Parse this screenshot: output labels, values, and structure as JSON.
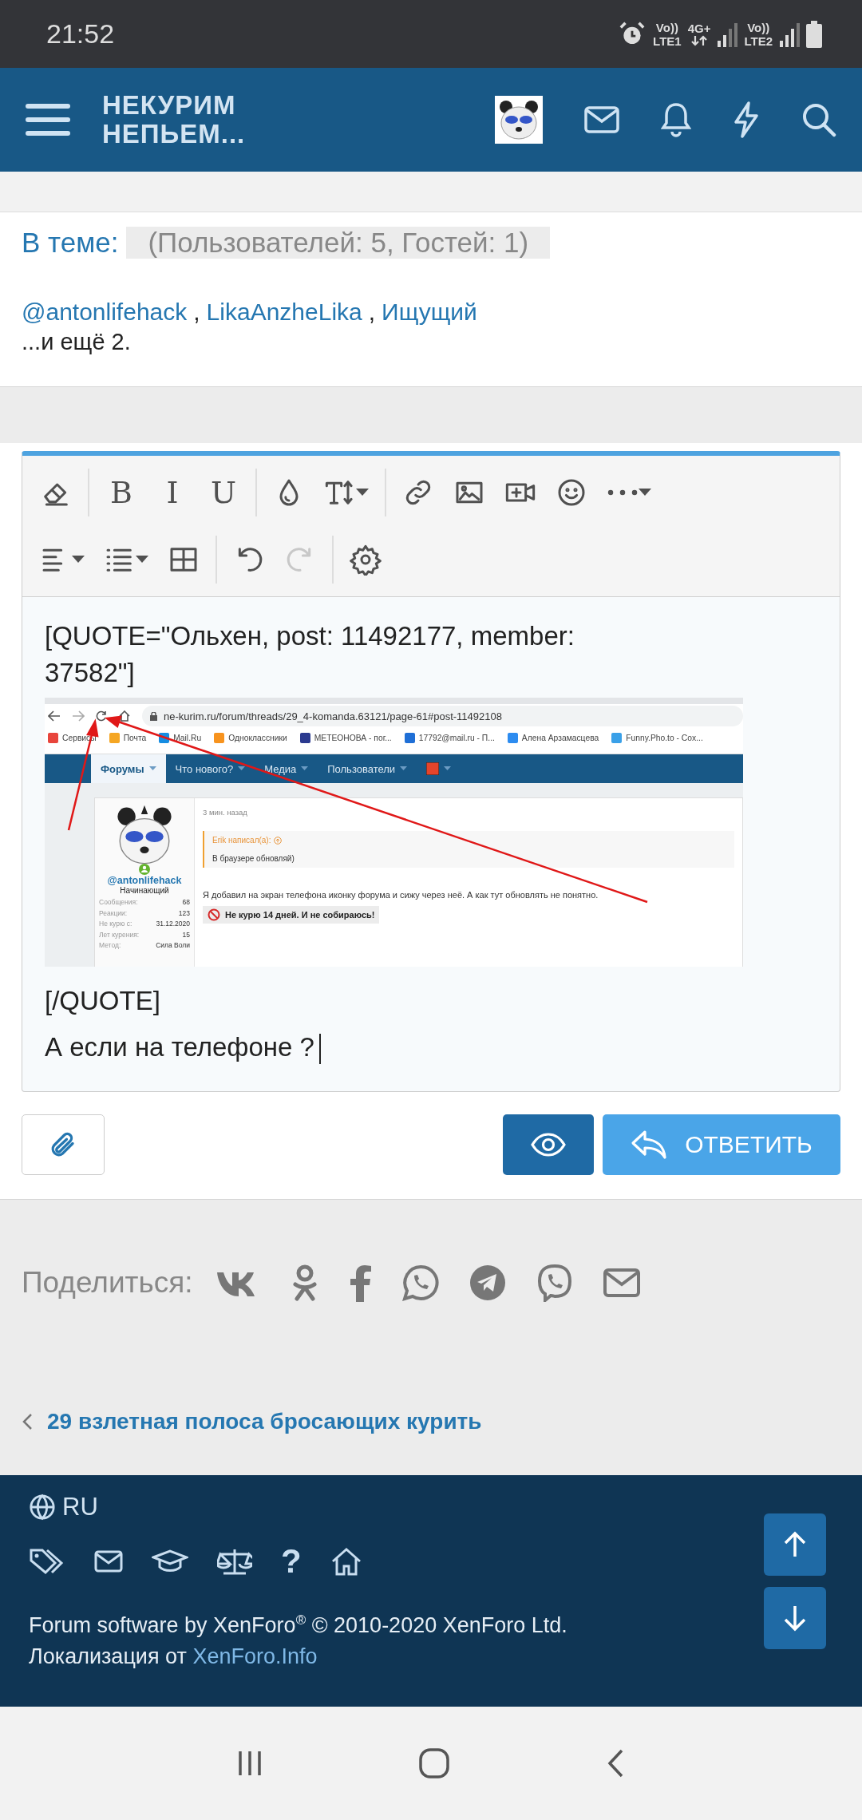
{
  "status_bar": {
    "time": "21:52",
    "sim1": {
      "voice": "Vo))",
      "network": "LTE1"
    },
    "data": "4G+",
    "sim2": {
      "voice": "Vo))",
      "network": "LTE2"
    }
  },
  "header": {
    "logo": [
      "НЕКУРИМ",
      "НЕПЬЕМ..."
    ]
  },
  "online": {
    "title": "В теме:",
    "counts": "(Пользователей: 5, Гостей: 1)",
    "users": [
      {
        "kind": "link",
        "text": "@antonlifehack"
      },
      {
        "kind": "separator",
        "text": ","
      },
      {
        "kind": "link",
        "text": "LikaAnzheLika"
      },
      {
        "kind": "separator",
        "text": ","
      },
      {
        "kind": "link",
        "text": "Ищущий"
      }
    ],
    "more": "...и ещё 2."
  },
  "editor": {
    "toolbar": [
      [
        [
          {
            "kind": "icon",
            "disabled": false,
            "dropdown": false
          }
        ],
        [
          {
            "kind": "label",
            "label": "B",
            "disabled": false,
            "dropdown": false
          },
          {
            "kind": "label",
            "label": "I",
            "disabled": false,
            "dropdown": false
          },
          {
            "kind": "label",
            "label": "U",
            "disabled": false,
            "dropdown": false
          }
        ],
        [
          {
            "kind": "icon",
            "disabled": false,
            "dropdown": false
          },
          {
            "kind": "icon",
            "disabled": false,
            "dropdown": true
          }
        ],
        [
          {
            "kind": "icon",
            "disabled": false,
            "dropdown": false
          },
          {
            "kind": "icon",
            "disabled": false,
            "dropdown": false
          },
          {
            "kind": "icon",
            "disabled": false,
            "dropdown": false
          },
          {
            "kind": "icon",
            "disabled": false,
            "dropdown": false
          },
          {
            "kind": "icon",
            "disabled": false,
            "dropdown": true
          }
        ]
      ],
      [
        [
          {
            "kind": "icon",
            "disabled": false,
            "dropdown": true
          },
          {
            "kind": "icon",
            "disabled": false,
            "dropdown": true
          },
          {
            "kind": "icon",
            "disabled": false,
            "dropdown": false
          }
        ],
        [
          {
            "kind": "icon",
            "disabled": false,
            "dropdown": false
          },
          {
            "kind": "icon",
            "disabled": true,
            "dropdown": false
          }
        ],
        [
          {
            "kind": "icon",
            "disabled": false,
            "dropdown": false
          }
        ]
      ]
    ],
    "quote_open": "[QUOTE=\"Ольхен, post: 11492177, member: 37582\"]",
    "screenshot": {
      "url": "ne-kurim.ru/forum/threads/29_4-komanda.63121/page-61#post-11492108",
      "bookmarks": [
        {
          "label": "Сервисы",
          "color": "#e8453c"
        },
        {
          "label": "Почта",
          "color": "#f5a623"
        },
        {
          "label": "Mail.Ru",
          "color": "#168de2"
        },
        {
          "label": "Одноклассники",
          "color": "#f7931e"
        },
        {
          "label": "МЕТЕОНОВА - пог...",
          "color": "#2b3a8f"
        },
        {
          "label": "17792@mail.ru - П...",
          "color": "#1f6fd6"
        },
        {
          "label": "Алена Арзамасцева",
          "color": "#2d8cf0"
        },
        {
          "label": "Funny.Pho.to - Cox...",
          "color": "#3aa0e8"
        }
      ],
      "nav": [
        {
          "label": "Форумы",
          "selected": true
        },
        {
          "label": "Что нового?",
          "selected": false
        },
        {
          "label": "Медиа",
          "selected": false
        },
        {
          "label": "Пользователи",
          "selected": false
        }
      ],
      "user": {
        "name": "@antonlifehack",
        "title": "Начинающий",
        "stats": [
          {
            "label": "Сообщения:",
            "value": "68"
          },
          {
            "label": "Реакции:",
            "value": "123"
          },
          {
            "label": "Не курю с:",
            "value": "31.12.2020"
          },
          {
            "label": "Лет курения:",
            "value": "15"
          },
          {
            "label": "Метод:",
            "value": "Сила Воли"
          }
        ]
      },
      "post": {
        "time": "3 мин. назад",
        "quote_author": "Erik написал(а):",
        "quote_text": "В браузере обновляй)",
        "message": "Я добавил на экран телефона иконку форума и сижу через неё. А как тут обновлять не понятно.",
        "banner": "Не курю 14 дней. И не собираюсь!"
      }
    },
    "quote_close": "[/QUOTE]",
    "text": "А если на телефоне ?"
  },
  "actions": {
    "reply": "ОТВЕТИТЬ"
  },
  "share": {
    "label": "Поделиться:"
  },
  "breadcrumb": {
    "label": "29 взлетная полоса бросающих курить"
  },
  "footer": {
    "language": "RU",
    "help": "?",
    "copyright": "Forum software by XenForo$^{®}$ © 2010-2020 XenForo Ltd.",
    "localization": "Локализация от",
    "localization_link": "XenForo.Info"
  }
}
